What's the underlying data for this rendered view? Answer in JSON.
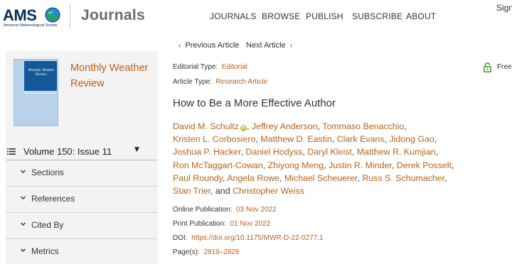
{
  "header": {
    "logo_text": "AMS",
    "logo_subtext": "American Meteorological Society",
    "site_title": "Journals",
    "nav": [
      "JOURNALS",
      "BROWSE",
      "PUBLISH",
      "SUBSCRIBE",
      "ABOUT"
    ],
    "sign_in": "Sign"
  },
  "article_nav": {
    "previous": "Previous Article",
    "next": "Next Article"
  },
  "sidebar": {
    "cover_title": "Monthly Weather Review",
    "journal_name": "Monthly Weather Review",
    "volume_label": "Volume 150: Issue 11",
    "sections": [
      "Sections",
      "References",
      "Cited By",
      "Metrics"
    ]
  },
  "article": {
    "editorial_type_label": "Editorial Type:",
    "editorial_type_value": "Editorial",
    "article_type_label": "Article Type:",
    "article_type_value": "Research Article",
    "access": "Free",
    "title": "How to Be a More Effective Author",
    "authors": [
      "David M. Schultz",
      "Jeffrey Anderson",
      "Tommaso Benacchio",
      "Kristen L. Corbosiero",
      "Matthew D. Eastin",
      "Clark Evans",
      "Jidong Gao",
      "Joshua P. Hacker",
      "Daniel Hodyss",
      "Daryl Kleist",
      "Matthew R. Kumjian",
      "Ron McTaggart-Cowan",
      "Zhiyong Meng",
      "Justin R. Minder",
      "Derek Posselt",
      "Paul Roundy",
      "Angela Rowe",
      "Michael Scheuerer",
      "Russ S. Schumacher",
      "Stan Trier",
      "Christopher Weiss"
    ],
    "orcid_badge": "iD",
    "author_separator": ", ",
    "author_final_separator": ", and ",
    "online_pub_label": "Online Publication:",
    "online_pub_value": "03 Nov 2022",
    "print_pub_label": "Print Publication:",
    "print_pub_value": "01 Nov 2022",
    "doi_label": "DOI:",
    "doi_value": "https://doi.org/10.1175/MWR-D-22-0277.1",
    "pages_label": "Page(s):",
    "pages_value": "2819–2828"
  },
  "colors": {
    "link": "#b8621b",
    "brand_navy": "#0a2a57",
    "sidebar_bg": "#f3f3f3",
    "orcid_green": "#a6ce39"
  }
}
